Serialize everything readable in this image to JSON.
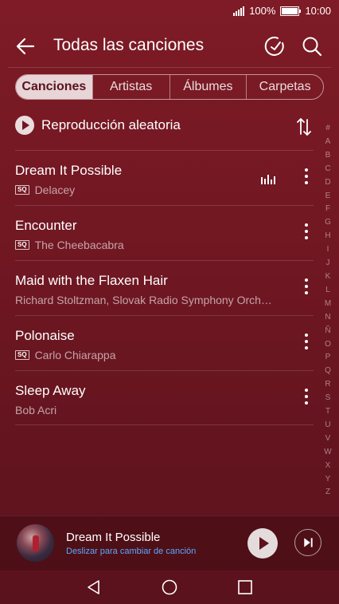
{
  "status": {
    "battery": "100%",
    "time": "10:00"
  },
  "header": {
    "title": "Todas las canciones"
  },
  "tabs": [
    {
      "label": "Canciones",
      "active": true
    },
    {
      "label": "Artistas",
      "active": false
    },
    {
      "label": "Álbumes",
      "active": false
    },
    {
      "label": "Carpetas",
      "active": false
    }
  ],
  "shuffle": {
    "label": "Reproducción aleatoria"
  },
  "songs": [
    {
      "title": "Dream It Possible",
      "artist": "Delacey",
      "sq": true,
      "playing": true
    },
    {
      "title": "Encounter",
      "artist": "The Cheebacabra",
      "sq": true,
      "playing": false
    },
    {
      "title": "Maid with the Flaxen Hair",
      "artist": "Richard Stoltzman, Slovak Radio Symphony Orch…",
      "sq": false,
      "playing": false
    },
    {
      "title": "Polonaise",
      "artist": "Carlo Chiarappa",
      "sq": true,
      "playing": false
    },
    {
      "title": "Sleep Away",
      "artist": "Bob Acri",
      "sq": false,
      "playing": false
    }
  ],
  "sq_label": "SQ",
  "alphabet": [
    "#",
    "A",
    "B",
    "C",
    "D",
    "E",
    "F",
    "G",
    "H",
    "I",
    "J",
    "K",
    "L",
    "M",
    "N",
    "Ñ",
    "O",
    "P",
    "Q",
    "R",
    "S",
    "T",
    "U",
    "V",
    "W",
    "X",
    "Y",
    "Z"
  ],
  "mini_player": {
    "title": "Dream It Possible",
    "subtitle": "Deslizar para cambiar de canción"
  },
  "colors": {
    "background": "#7e1b26",
    "accent_link": "#5aa9ff"
  },
  "icons": {
    "back": "back-arrow-icon",
    "sleep_timer": "timer-icon",
    "search": "search-icon",
    "sort": "sort-icon",
    "more": "more-vertical-icon",
    "equalizer": "equalizer-icon"
  }
}
